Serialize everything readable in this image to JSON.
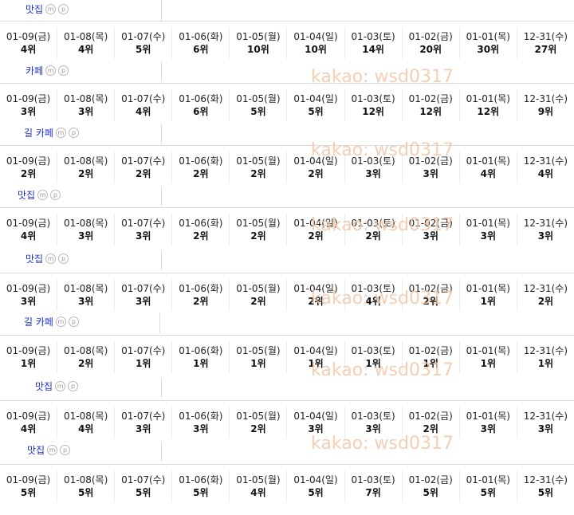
{
  "dates": [
    "01-09(금)",
    "01-08(목)",
    "01-07(수)",
    "01-06(화)",
    "01-05(월)",
    "01-04(일)",
    "01-03(토)",
    "01-02(금)",
    "01-01(목)",
    "12-31(수)"
  ],
  "watermark": "kakao: wsd0317",
  "blocks": [
    {
      "title": "맛집",
      "ranks": [
        "4위",
        "4위",
        "5위",
        "6위",
        "10위",
        "10위",
        "14위",
        "20위",
        "30위",
        "27위"
      ]
    },
    {
      "title": "카페",
      "ranks": [
        "3위",
        "3위",
        "4위",
        "6위",
        "5위",
        "5위",
        "12위",
        "12위",
        "12위",
        "9위"
      ]
    },
    {
      "title": "길 카페",
      "ranks": [
        "2위",
        "2위",
        "2위",
        "2위",
        "2위",
        "2위",
        "3위",
        "3위",
        "4위",
        "4위"
      ]
    },
    {
      "title": "맛집",
      "ranks": [
        "4위",
        "3위",
        "3위",
        "2위",
        "2위",
        "2위",
        "2위",
        "3위",
        "3위",
        "3위"
      ]
    },
    {
      "title": "맛집",
      "ranks": [
        "3위",
        "3위",
        "3위",
        "2위",
        "2위",
        "2위",
        "4위",
        "2위",
        "1위",
        "2위"
      ]
    },
    {
      "title": "길 카페",
      "ranks": [
        "1위",
        "2위",
        "1위",
        "1위",
        "1위",
        "1위",
        "1위",
        "1위",
        "1위",
        "1위"
      ]
    },
    {
      "title": "맛집",
      "ranks": [
        "4위",
        "4위",
        "3위",
        "3위",
        "2위",
        "3위",
        "3위",
        "2위",
        "3위",
        "3위"
      ]
    },
    {
      "title": "맛집",
      "ranks": [
        "5위",
        "5위",
        "5위",
        "5위",
        "4위",
        "5위",
        "7위",
        "5위",
        "5위",
        "5위"
      ]
    }
  ]
}
